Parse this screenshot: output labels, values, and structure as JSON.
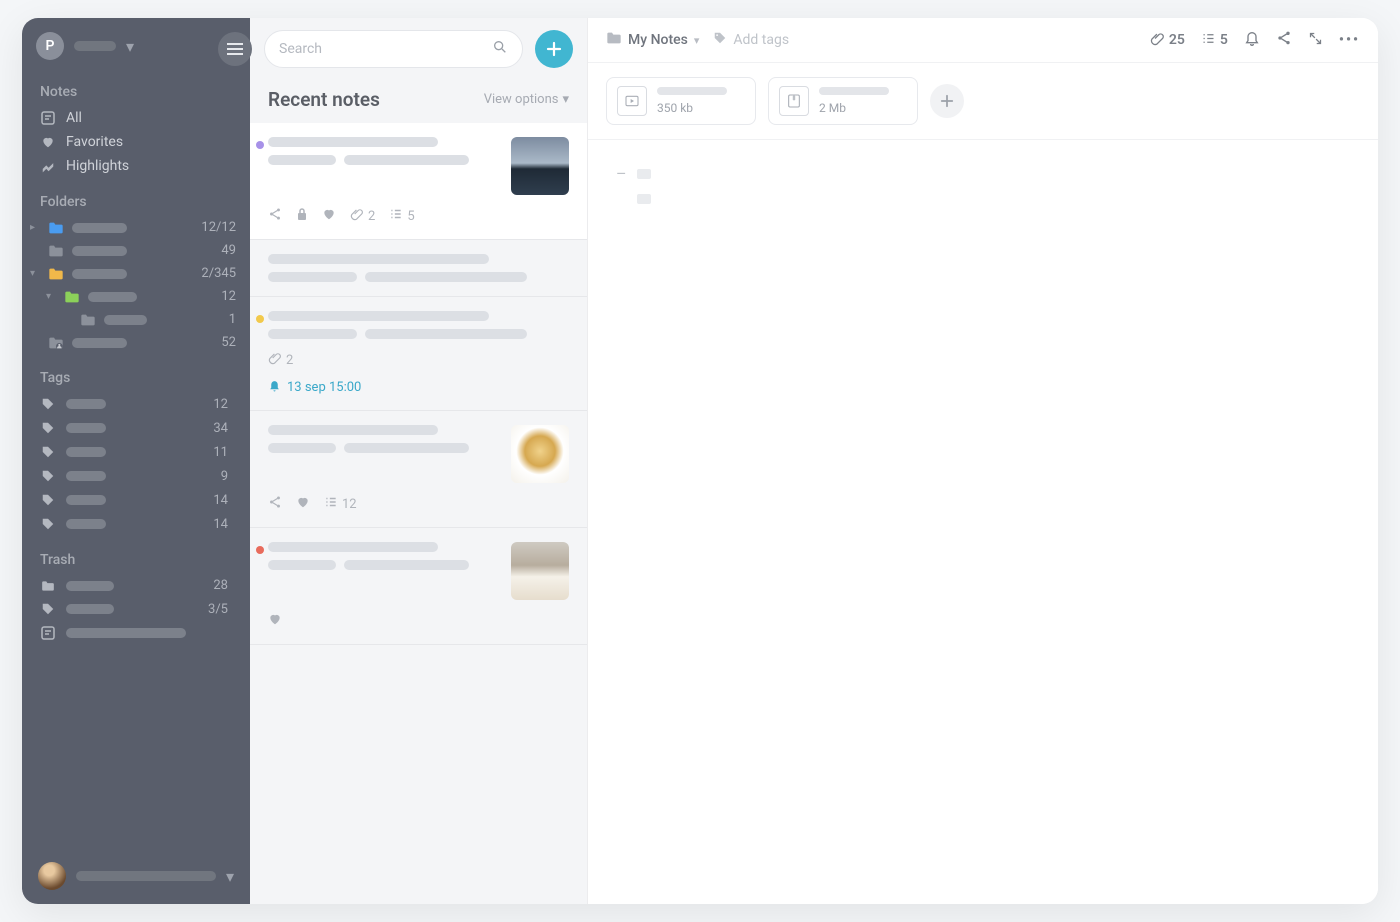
{
  "sidebar": {
    "avatar_letter": "P",
    "sections": {
      "notes_title": "Notes",
      "folders_title": "Folders",
      "tags_title": "Tags",
      "trash_title": "Trash"
    },
    "nav": {
      "all": "All",
      "favorites": "Favorites",
      "highlights": "Highlights"
    },
    "folders": [
      {
        "color": "#4a9cf0",
        "count": "12/12",
        "indent": 0,
        "caret": "right"
      },
      {
        "color": "#8c919b",
        "count": "49",
        "indent": 0,
        "caret": "none"
      },
      {
        "color": "#f0b84a",
        "count": "2/345",
        "indent": 0,
        "caret": "down"
      },
      {
        "color": "#8cd15a",
        "count": "12",
        "indent": 1,
        "caret": "down"
      },
      {
        "color": "#8c919b",
        "count": "1",
        "indent": 2,
        "caret": "none"
      },
      {
        "color": "#8c919b",
        "count": "52",
        "indent": 0,
        "caret": "none",
        "shared": true
      }
    ],
    "tags": [
      {
        "count": "12"
      },
      {
        "count": "34"
      },
      {
        "count": "11"
      },
      {
        "count": "9"
      },
      {
        "count": "14"
      },
      {
        "count": "14"
      }
    ],
    "trash": [
      {
        "icon": "folder",
        "count": "28"
      },
      {
        "icon": "tag",
        "count": "3/5"
      },
      {
        "icon": "note",
        "count": ""
      }
    ]
  },
  "list": {
    "search_placeholder": "Search",
    "title": "Recent notes",
    "view_options": "View options",
    "notes": [
      {
        "active": true,
        "dot": "#a791e8",
        "thumb_gradient": "linear-gradient(180deg,#7d8ca0 0%,#aab9c8 45%,#1f2a36 55%,#2f3e4e 100%)",
        "meta": [
          {
            "icon": "share"
          },
          {
            "icon": "lock"
          },
          {
            "icon": "heart"
          },
          {
            "icon": "clip",
            "value": "2"
          },
          {
            "icon": "list",
            "value": "5"
          }
        ]
      },
      {
        "active": false,
        "dot": null,
        "thumb_gradient": null,
        "meta": []
      },
      {
        "active": false,
        "dot": "#f2c94c",
        "thumb_gradient": null,
        "meta": [
          {
            "icon": "clip",
            "value": "2"
          }
        ],
        "reminder": "13 sep 15:00"
      },
      {
        "active": false,
        "dot": null,
        "thumb_gradient": "radial-gradient(circle at 50% 45%, #f0d28b 0%, #d6a850 35%, #fff 55%, #f4f1ea 100%)",
        "meta": [
          {
            "icon": "share"
          },
          {
            "icon": "heart"
          },
          {
            "icon": "list",
            "value": "12"
          }
        ]
      },
      {
        "active": false,
        "dot": "#e86b5c",
        "thumb_gradient": "linear-gradient(180deg,#cfcac2 0%,#b7ad9e 40%,#f5f1e9 60%,#e6ddcd 100%)",
        "meta": [
          {
            "icon": "heart"
          }
        ]
      }
    ]
  },
  "editor": {
    "crumb_label": "My Notes",
    "add_tags_label": "Add tags",
    "actions": {
      "attachments_count": "25",
      "checklist_count": "5"
    },
    "attachments": [
      {
        "type": "video",
        "size": "350 kb"
      },
      {
        "type": "archive",
        "size": "2 Mb"
      }
    ]
  }
}
